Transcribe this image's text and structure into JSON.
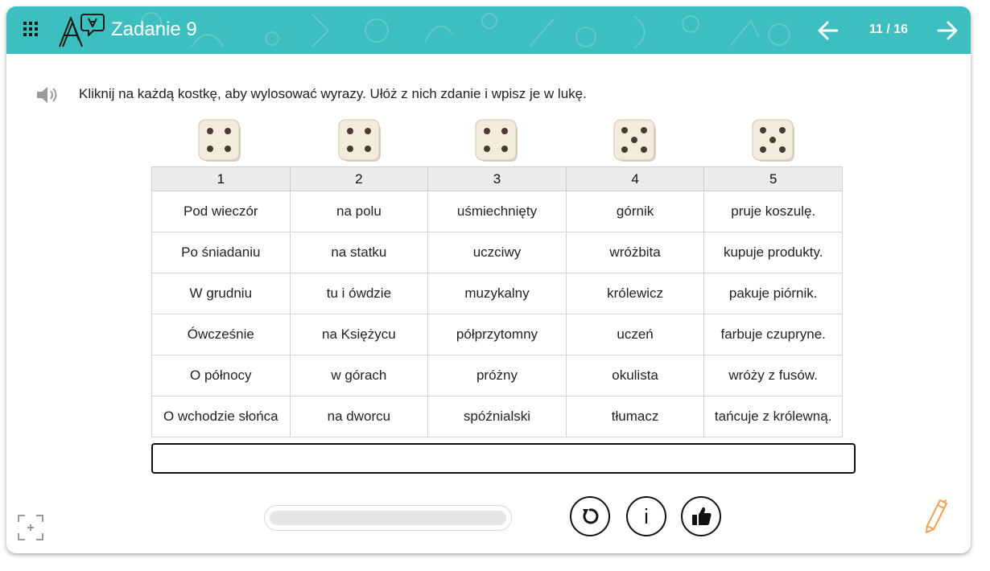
{
  "header": {
    "title": "Zadanie 9",
    "page_counter": "11 / 16",
    "background_color": "#3dbfbf"
  },
  "instruction": "Kliknij na każdą kostkę, aby wylosować wyrazy. Ułóż z nich zdanie i wpisz je w lukę.",
  "dice": [
    {
      "pips": 4
    },
    {
      "pips": 4
    },
    {
      "pips": 4
    },
    {
      "pips": 5
    },
    {
      "pips": 5
    }
  ],
  "table": {
    "headers": [
      "1",
      "2",
      "3",
      "4",
      "5"
    ],
    "rows": [
      [
        "Pod wieczór",
        "na polu",
        "uśmiechnięty",
        "górnik",
        "pruje koszulę."
      ],
      [
        "Po śniadaniu",
        "na statku",
        "uczciwy",
        "wróżbita",
        "kupuje produkty."
      ],
      [
        "W grudniu",
        "tu i ówdzie",
        "muzykalny",
        "królewicz",
        "pakuje piórnik."
      ],
      [
        "Ówcześnie",
        "na Księżycu",
        "półprzytomny",
        "uczeń",
        "farbuje czupryne."
      ],
      [
        "O północy",
        "w górach",
        "próżny",
        "okulista",
        "wróży z fusów."
      ],
      [
        "O wchodzie słońca",
        "na dworcu",
        "spóźnialski",
        "tłumacz",
        "tańcuje z królewną."
      ]
    ]
  },
  "answer": {
    "value": "",
    "placeholder": ""
  },
  "controls": {
    "info_label": "i"
  },
  "icons": {
    "menu": "grid-menu-icon",
    "prev": "arrow-left-icon",
    "next": "arrow-right-icon",
    "speaker": "speaker-icon",
    "reset": "reset-icon",
    "check": "thumbs-up-icon",
    "fullscreen": "fullscreen-icon",
    "pen": "pen-icon"
  },
  "colors": {
    "accent": "#3dbfbf",
    "pen": "#f0a050"
  }
}
